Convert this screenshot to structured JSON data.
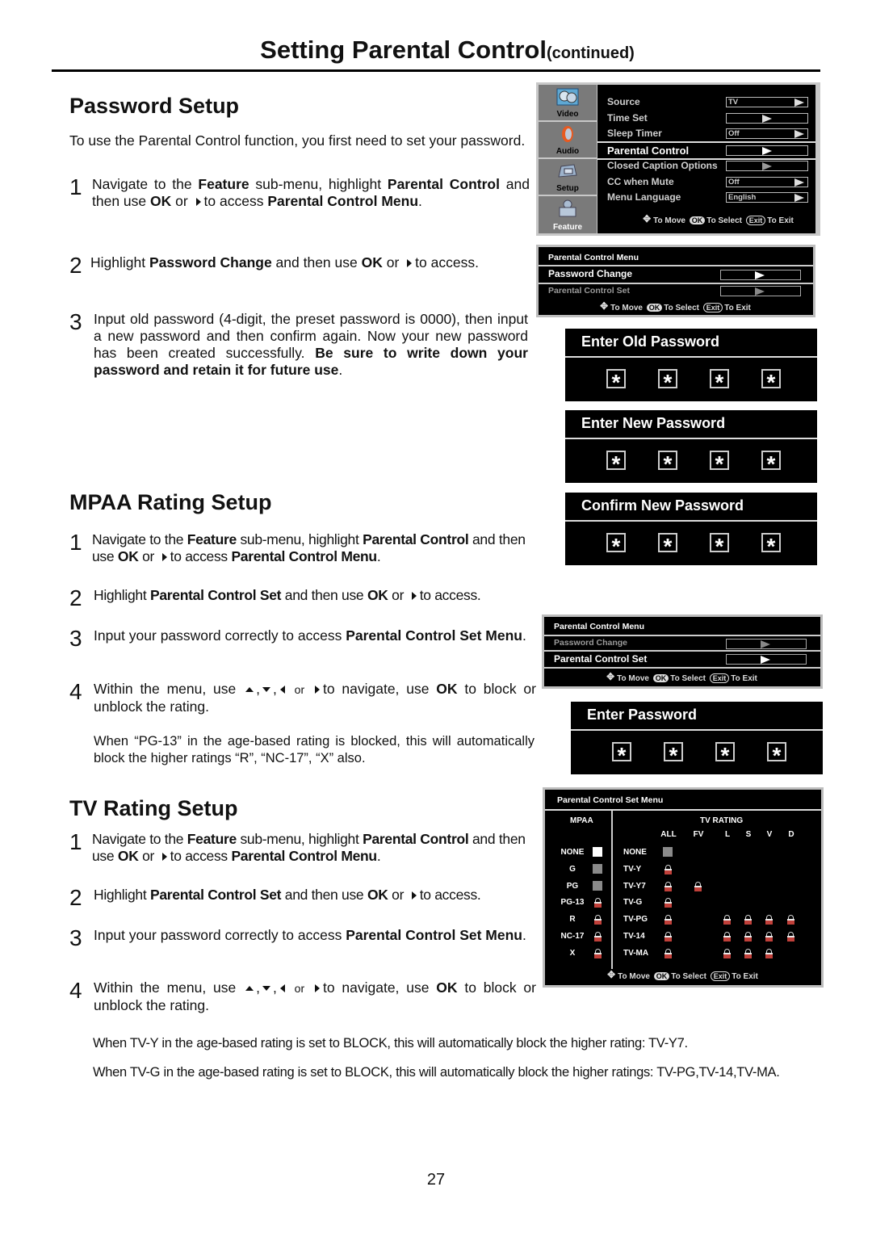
{
  "page": {
    "title": "Setting Parental Control",
    "title_suffix": "(continued)",
    "page_number": "27"
  },
  "password_setup": {
    "heading": "Password Setup",
    "intro": "To use the Parental Control function, you first need to set your password.",
    "steps": [
      {
        "num": "1",
        "parts": [
          "Navigate to the ",
          "Feature",
          " sub-menu, highlight ",
          "Parental Control",
          " and then use ",
          "OK",
          " or ",
          "to access ",
          "Parental Control Menu",
          "."
        ]
      },
      {
        "num": "2",
        "parts": [
          "Highlight ",
          "Password Change",
          " and then use ",
          "OK",
          " or ",
          "to access."
        ]
      },
      {
        "num": "3",
        "parts": [
          "Input old password (4-digit, the preset password is 0000), then input a new password and then confirm again. Now your new password has been created successfully. ",
          "Be sure to write down your password and retain it for future use",
          "."
        ]
      }
    ]
  },
  "mpaa_setup": {
    "heading": "MPAA Rating  Setup",
    "steps": [
      {
        "num": "1",
        "parts": [
          "Navigate to the ",
          "Feature",
          " sub-menu, highlight ",
          "Parental Control",
          " and then use ",
          "OK",
          " or ",
          "to access ",
          "Parental Control Menu",
          "."
        ]
      },
      {
        "num": "2",
        "parts": [
          "Highlight ",
          "Parental Control Set",
          " and then use ",
          "OK",
          " or ",
          "to access."
        ]
      },
      {
        "num": "3",
        "parts": [
          "Input your password correctly to access ",
          "Parental Control Set Menu",
          "."
        ]
      },
      {
        "num": "4",
        "parts": [
          "Within the menu, use ",
          ",",
          ",",
          " or ",
          "to navigate, use ",
          "OK",
          " to block or unblock the rating."
        ]
      }
    ],
    "note": "When “PG-13” in the age-based rating is blocked, this will automatically block the higher ratings “R”, “NC-17”, “X” also."
  },
  "tv_setup": {
    "heading": "TV Rating  Setup",
    "steps": [
      {
        "num": "1",
        "parts": [
          "Navigate to the ",
          "Feature",
          " sub-menu, highlight ",
          "Parental Control",
          " and then use ",
          "OK",
          " or ",
          "to access ",
          "Parental Control Menu",
          "."
        ]
      },
      {
        "num": "2",
        "parts": [
          "Highlight ",
          "Parental Control Set",
          " and then use ",
          "OK",
          " or ",
          "to access."
        ]
      },
      {
        "num": "3",
        "parts": [
          "Input your password correctly to access ",
          "Parental Control Set Menu",
          "."
        ]
      },
      {
        "num": "4",
        "parts": [
          "Within the menu, use ",
          ",",
          ",",
          " or ",
          "to navigate, use ",
          "OK",
          " to block or unblock the rating."
        ]
      }
    ],
    "notes": [
      "When TV-Y in the age-based rating is set to BLOCK, this will automatically block the higher rating: TV-Y7.",
      "When TV-G in the age-based rating is set to BLOCK, this will automatically block the higher ratings: TV-PG,TV-14,TV-MA."
    ]
  },
  "main_menu": {
    "tabs": [
      {
        "label": "Video",
        "icon": "video-icon"
      },
      {
        "label": "Audio",
        "icon": "speaker-icon"
      },
      {
        "label": "Setup",
        "icon": "setup-icon"
      },
      {
        "label": "Feature",
        "icon": "feature-icon",
        "active": true
      }
    ],
    "rows": [
      {
        "label": "Source",
        "value": "TV"
      },
      {
        "label": "Time Set",
        "value": ""
      },
      {
        "label": "Sleep Timer",
        "value": "Off"
      },
      {
        "label": "Parental Control",
        "value": "",
        "highlighted": true
      },
      {
        "label": "Closed Caption Options",
        "value": ""
      },
      {
        "label": "CC when Mute",
        "value": "Off"
      },
      {
        "label": "Menu Language",
        "value": "English"
      }
    ]
  },
  "hint_bar": {
    "move": "To Move",
    "ok_key": "OK",
    "select": "To Select",
    "exit_key": "Exit",
    "exit": "To Exit"
  },
  "pc_menu": {
    "title": "Parental Control Menu",
    "items": [
      "Password Change",
      "Parental Control Set"
    ]
  },
  "password_boxes": {
    "old": "Enter Old Password",
    "new": "Enter New Password",
    "confirm": "Confirm New Password",
    "enter": "Enter Password",
    "mask": "*"
  },
  "pcs_menu": {
    "title": "Parental Control Set Menu",
    "mpaa_header": "MPAA",
    "tv_header": "TV RATING",
    "tv_columns": [
      "ALL",
      "FV",
      "L",
      "S",
      "V",
      "D"
    ],
    "mpaa_rows": [
      {
        "label": "NONE",
        "state": "unblocked-selected"
      },
      {
        "label": "G",
        "state": "unblocked"
      },
      {
        "label": "PG",
        "state": "unblocked"
      },
      {
        "label": "PG-13",
        "state": "locked"
      },
      {
        "label": "R",
        "state": "locked"
      },
      {
        "label": "NC-17",
        "state": "locked"
      },
      {
        "label": "X",
        "state": "locked"
      }
    ],
    "tv_rows": [
      {
        "label": "NONE",
        "cells": [
          "unblocked",
          "",
          "",
          "",
          "",
          ""
        ]
      },
      {
        "label": "TV-Y",
        "cells": [
          "locked",
          "",
          "",
          "",
          "",
          ""
        ]
      },
      {
        "label": "TV-Y7",
        "cells": [
          "locked",
          "locked",
          "",
          "",
          "",
          ""
        ]
      },
      {
        "label": "TV-G",
        "cells": [
          "locked",
          "",
          "",
          "",
          "",
          ""
        ]
      },
      {
        "label": "TV-PG",
        "cells": [
          "locked",
          "",
          "locked",
          "locked",
          "locked",
          "locked"
        ]
      },
      {
        "label": "TV-14",
        "cells": [
          "locked",
          "",
          "locked",
          "locked",
          "locked",
          "locked"
        ]
      },
      {
        "label": "TV-MA",
        "cells": [
          "locked",
          "",
          "locked",
          "locked",
          "locked",
          ""
        ]
      }
    ]
  },
  "colors": {
    "osd_bg": "#000000",
    "osd_frame": "#bdbdbd",
    "lock_red": "#c0403a",
    "tab_gray": "#7a7a7a"
  }
}
